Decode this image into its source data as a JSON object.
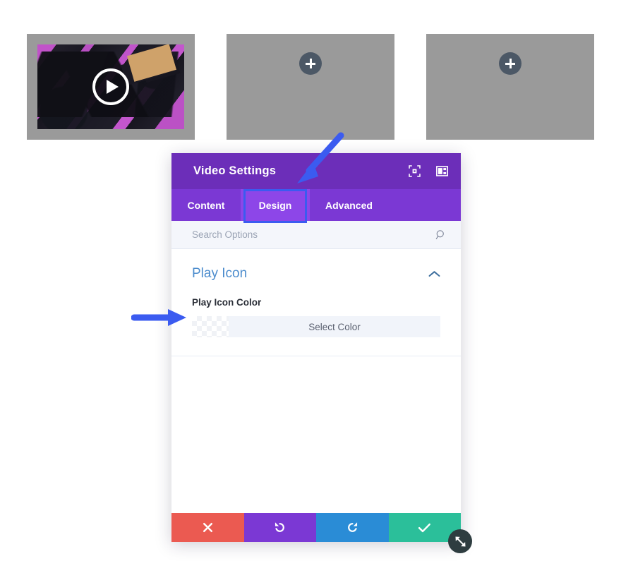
{
  "builder": {
    "modules": [
      {
        "type": "video-module",
        "name": "video-module",
        "play_icon": "play-icon"
      },
      {
        "type": "empty-module",
        "name": "empty-module-2",
        "add_icon": "plus-icon"
      },
      {
        "type": "empty-module",
        "name": "empty-module-3",
        "add_icon": "plus-icon"
      }
    ]
  },
  "modal": {
    "title": "Video Settings",
    "header_icons": [
      {
        "name": "expand-icon",
        "label": "expand"
      },
      {
        "name": "layout-view-icon",
        "label": "layout"
      }
    ],
    "tabs": [
      {
        "label": "Content",
        "active": false
      },
      {
        "label": "Design",
        "active": true
      },
      {
        "label": "Advanced",
        "active": false
      }
    ],
    "search": {
      "placeholder": "Search Options",
      "value": "",
      "icon": "search-icon"
    },
    "sections": [
      {
        "title": "Play Icon",
        "collapse_icon": "chevron-up-icon",
        "expanded": true,
        "fields": [
          {
            "label": "Play Icon Color",
            "swatch": "transparent",
            "button_label": "Select Color"
          }
        ]
      }
    ],
    "footer_buttons": [
      {
        "name": "cancel-button",
        "icon": "close-icon",
        "color": "#eb5a51"
      },
      {
        "name": "undo-button",
        "icon": "undo-icon",
        "color": "#7b38d4"
      },
      {
        "name": "redo-button",
        "icon": "redo-icon",
        "color": "#2a8cd6"
      },
      {
        "name": "save-button",
        "icon": "check-icon",
        "color": "#2bbf9a"
      }
    ],
    "resize_handle_icon": "resize-diagonal-icon"
  },
  "annotations": [
    {
      "name": "design-tab-highlight",
      "type": "box",
      "color": "#3b5bf0"
    },
    {
      "name": "design-tab-arrow",
      "type": "arrow",
      "color": "#3b5bf0",
      "direction": "down-left"
    },
    {
      "name": "play-icon-color-arrow",
      "type": "arrow",
      "color": "#3b5bf0",
      "direction": "right"
    }
  ],
  "colors": {
    "header_purple": "#6c2eb9",
    "tabbar_purple": "#7b38d4",
    "active_tab_purple": "#8d46e8",
    "section_title_blue": "#4c8ccd",
    "annotation_blue": "#3b5bf0",
    "module_gray": "#9a9a9a"
  }
}
